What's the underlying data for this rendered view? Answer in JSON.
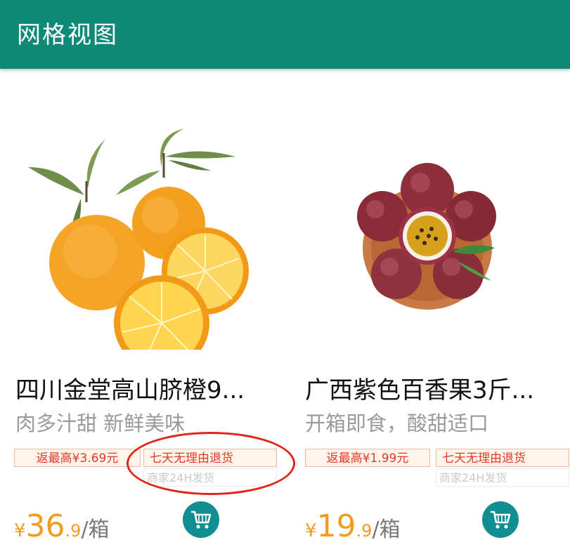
{
  "app_bar": {
    "title": "网格视图"
  },
  "products": [
    {
      "title": "四川金堂高山脐橙9...",
      "subtitle": "肉多汁甜 新鲜美味",
      "rebate_tag": "返最高¥3.69元",
      "return_tag": "七天无理由退货",
      "ship_tag": "商家24H发货",
      "price": {
        "currency": "¥",
        "integer": "36",
        "decimal": ".9",
        "unit": "/箱"
      }
    },
    {
      "title": "广西紫色百香果3斤...",
      "subtitle": "开箱即食，酸甜适口",
      "rebate_tag": "返最高¥1.99元",
      "return_tag": "七天无理由退货",
      "ship_tag": "商家24H发货",
      "price": {
        "currency": "¥",
        "integer": "19",
        "decimal": ".9",
        "unit": "/箱"
      }
    }
  ],
  "colors": {
    "app_bar": "#0f8a78",
    "price": "#f39b1d",
    "tag_text": "#e23a2a",
    "cart_button": "#108e92",
    "annotation_circle": "#e2231a"
  },
  "icons": [
    "shopping-cart-icon"
  ]
}
